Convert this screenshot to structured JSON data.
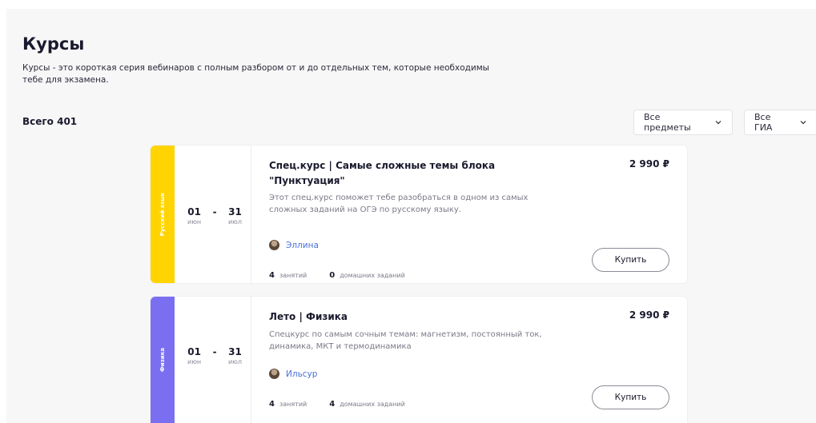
{
  "header": {
    "title": "Курсы",
    "description": "Курсы - это короткая серия вебинаров с полным разбором от и до отдельных тем, которые необходимы тебе для экзамена."
  },
  "filters": {
    "total": "Всего 401",
    "subject_select": "Все предметы",
    "exam_select": "Все ГИА",
    "chevron_icon": "chevron-down-icon"
  },
  "colors": {
    "russian": "#ffd400",
    "physics": "#7a6ff0",
    "link": "#4a6fd8"
  },
  "courses": [
    {
      "subject": "Русский язык",
      "start_day": "01",
      "start_month": "июн",
      "dash": "-",
      "end_day": "31",
      "end_month": "июл",
      "title": "Спец.курс | Самые сложные темы блока \"Пунктуация\"",
      "price": "2 990 ₽",
      "description": "Этот спец.курс поможет тебе разобраться в одном из самых сложных заданий на ОГЭ по русскому языку.",
      "teacher": "Эллина",
      "lessons_count": "4",
      "lessons_label": "занятий",
      "homework_count": "0",
      "homework_label": "домашних заданий",
      "buy_label": "Купить"
    },
    {
      "subject": "Физика",
      "start_day": "01",
      "start_month": "июн",
      "dash": "-",
      "end_day": "31",
      "end_month": "июл",
      "title": "Лето | Физика",
      "price": "2 990 ₽",
      "description": "Спецкурс по самым сочным темам: магнетизм, постоянный ток, динамика, МКТ и термодинамика",
      "teacher": "Ильсур",
      "lessons_count": "4",
      "lessons_label": "занятий",
      "homework_count": "4",
      "homework_label": "домашних заданий",
      "buy_label": "Купить"
    }
  ]
}
